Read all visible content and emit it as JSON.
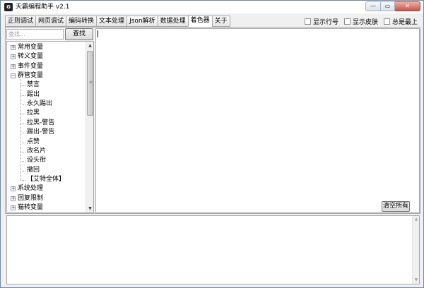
{
  "window": {
    "title": "天霸编程助手 v2.1",
    "icon_label": "G",
    "controls": {
      "minimize": "—",
      "maximize": "▭",
      "close": "✕"
    }
  },
  "tabs": [
    {
      "label": "正则调试"
    },
    {
      "label": "网页调试"
    },
    {
      "label": "编码转换"
    },
    {
      "label": "文本处理"
    },
    {
      "label": "Json解析"
    },
    {
      "label": "数据处理"
    },
    {
      "label": "着色器",
      "active": true
    },
    {
      "label": "关于"
    }
  ],
  "options": [
    {
      "label": "显示行号",
      "checked": false
    },
    {
      "label": "显示皮肤",
      "checked": false
    },
    {
      "label": "总是最上",
      "checked": false
    }
  ],
  "search": {
    "placeholder": "查找...",
    "value": "",
    "button_label": "查找"
  },
  "tree": {
    "items": [
      {
        "label": "常用变量",
        "level": 0,
        "state": "collapsed"
      },
      {
        "label": "转义变量",
        "level": 0,
        "state": "collapsed"
      },
      {
        "label": "事件变量",
        "level": 0,
        "state": "collapsed"
      },
      {
        "label": "群管变量",
        "level": 0,
        "state": "expanded"
      },
      {
        "label": "禁言",
        "level": 1
      },
      {
        "label": "踢出",
        "level": 1
      },
      {
        "label": "永久踢出",
        "level": 1
      },
      {
        "label": "拉黑",
        "level": 1
      },
      {
        "label": "拉黑-警告",
        "level": 1
      },
      {
        "label": "踢出-警告",
        "level": 1
      },
      {
        "label": "点赞",
        "level": 1
      },
      {
        "label": "改名片",
        "level": 1
      },
      {
        "label": "设头衔",
        "level": 1
      },
      {
        "label": "撤回",
        "level": 1
      },
      {
        "label": "【艾特全体】",
        "level": 1
      },
      {
        "label": "系统处理",
        "level": 0,
        "state": "collapsed"
      },
      {
        "label": "回复限制",
        "level": 0,
        "state": "collapsed"
      },
      {
        "label": "猫转变量",
        "level": 0,
        "state": "collapsed"
      }
    ]
  },
  "editor": {
    "content": ""
  },
  "clear_button_label": "清空所有",
  "output": {
    "content": ""
  }
}
